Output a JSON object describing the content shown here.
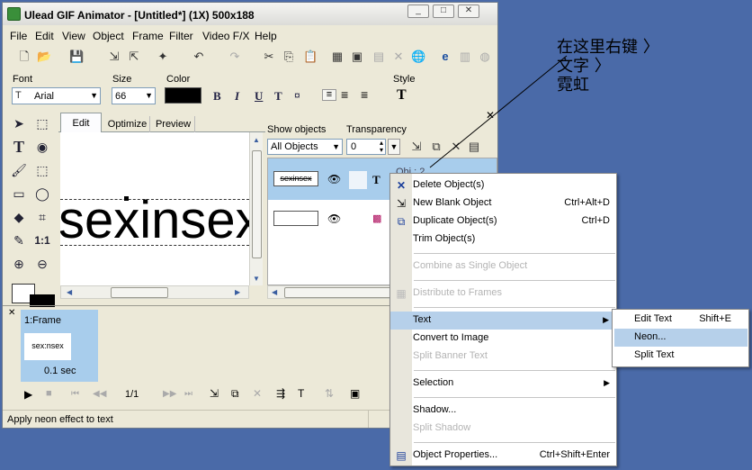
{
  "window": {
    "title": "Ulead GIF Animator - [Untitled*] (1X) 500x188"
  },
  "menu": [
    "File",
    "Edit",
    "View",
    "Object",
    "Frame",
    "Filter",
    "Video F/X",
    "Help"
  ],
  "font": {
    "font_label": "Font",
    "font_value": "Arial",
    "size_label": "Size",
    "size_value": "66",
    "color_label": "Color",
    "style_label": "Style"
  },
  "format_buttons": [
    "B",
    "I",
    "U",
    "T",
    "¤"
  ],
  "tabs": [
    "Edit",
    "Optimize",
    "Preview"
  ],
  "canvas": {
    "text": "sexinsex"
  },
  "objects": {
    "show_label": "Show objects",
    "show_value": "All Objects",
    "transparency_label": "Transparency",
    "transparency_value": "0",
    "row1_thumb": "sexinsex",
    "row1_type": "T",
    "row1_name": "Obj : 2"
  },
  "frames": {
    "frame_label": "1:Frame",
    "frame_thumb": "sex:nsex",
    "frame_delay": "0.1 sec",
    "counter": "1/1"
  },
  "status": "Apply neon effect to text",
  "context_menu": {
    "items": [
      {
        "label": "Delete Object(s)",
        "shortcut": ""
      },
      {
        "label": "New Blank Object",
        "shortcut": "Ctrl+Alt+D"
      },
      {
        "label": "Duplicate Object(s)",
        "shortcut": "Ctrl+D"
      },
      {
        "label": "Trim Object(s)",
        "shortcut": ""
      },
      {
        "label": "Combine as Single Object",
        "shortcut": ""
      },
      {
        "label": "Distribute to Frames",
        "shortcut": ""
      },
      {
        "label": "Text",
        "shortcut": ""
      },
      {
        "label": "Convert to Image",
        "shortcut": ""
      },
      {
        "label": "Split Banner Text",
        "shortcut": ""
      },
      {
        "label": "Selection",
        "shortcut": ""
      },
      {
        "label": "Shadow...",
        "shortcut": ""
      },
      {
        "label": "Split Shadow",
        "shortcut": ""
      },
      {
        "label": "Object Properties...",
        "shortcut": "Ctrl+Shift+Enter"
      }
    ]
  },
  "submenu": {
    "items": [
      {
        "label": "Edit Text",
        "shortcut": "Shift+E"
      },
      {
        "label": "Neon...",
        "shortcut": ""
      },
      {
        "label": "Split Text",
        "shortcut": ""
      }
    ]
  },
  "annotation": {
    "line1": "在这里右键 〉",
    "line2": "文字 〉",
    "line3": "霓虹"
  },
  "colors": {
    "highlight": "#b6d0ea",
    "frame_selected": "#a8cdec",
    "color_swatch": "#000000",
    "desktop": "#4a6aa8"
  }
}
